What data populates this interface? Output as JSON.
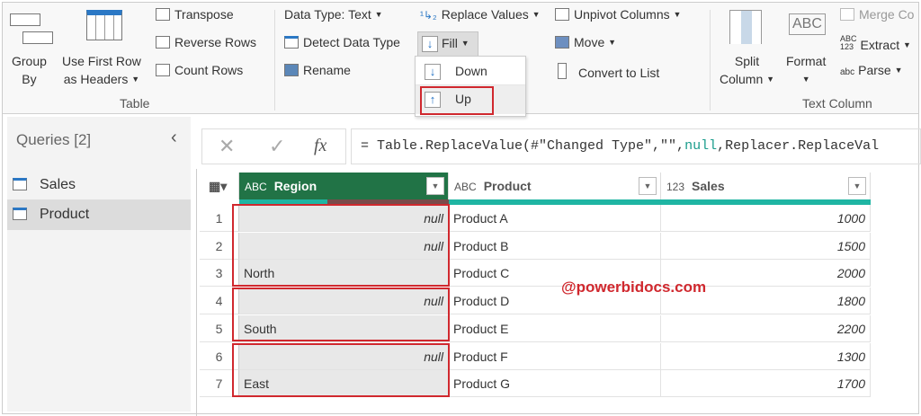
{
  "ribbon": {
    "group_by": [
      "Group",
      "By"
    ],
    "use_first_row": [
      "Use First Row",
      "as Headers"
    ],
    "transpose": "Transpose",
    "reverse_rows": "Reverse Rows",
    "count_rows": "Count Rows",
    "table_group": "Table",
    "data_type": "Data Type: Text",
    "detect_data_type": "Detect Data Type",
    "rename": "Rename",
    "replace_values": "Replace Values",
    "fill": "Fill",
    "unpivot_columns": "Unpivot Columns",
    "move": "Move",
    "convert_to_list": "Convert to List",
    "split_column": [
      "Split",
      "Column"
    ],
    "format": "Format",
    "merge_columns": "Merge Co",
    "extract": "Extract",
    "parse": "Parse",
    "text_column_group": "Text Column",
    "fill_menu": {
      "down": "Down",
      "up": "Up"
    }
  },
  "queries": {
    "title": "Queries [2]",
    "items": [
      "Sales",
      "Product"
    ],
    "selected": "Product"
  },
  "formula_bar": {
    "prefix": "= Table.ReplaceValue(#\"Changed Type\",\"\",",
    "null_kw": "null",
    "suffix": ",Replacer.ReplaceVal"
  },
  "table": {
    "columns": [
      {
        "type": "ABC",
        "name": "Region"
      },
      {
        "type": "ABC",
        "name": "Product"
      },
      {
        "type": "123",
        "name": "Sales"
      }
    ],
    "rows": [
      {
        "n": "1",
        "region": "null",
        "product": "Product A",
        "sales": "1000"
      },
      {
        "n": "2",
        "region": "null",
        "product": "Product B",
        "sales": "1500"
      },
      {
        "n": "3",
        "region": "North",
        "product": "Product C",
        "sales": "2000"
      },
      {
        "n": "4",
        "region": "null",
        "product": "Product D",
        "sales": "1800"
      },
      {
        "n": "5",
        "region": "South",
        "product": "Product E",
        "sales": "2200"
      },
      {
        "n": "6",
        "region": "null",
        "product": "Product F",
        "sales": "1300"
      },
      {
        "n": "7",
        "region": "East",
        "product": "Product G",
        "sales": "1700"
      }
    ]
  },
  "watermark": "@powerbidocs.com",
  "colors": {
    "header_selected": "#217346",
    "highlight": "#d0282e",
    "teal": "#1fb5a3"
  }
}
